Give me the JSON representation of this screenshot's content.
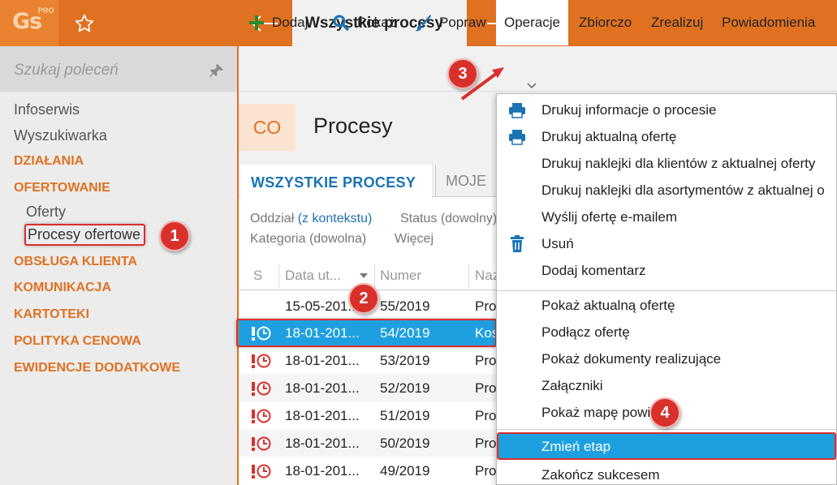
{
  "app": {
    "logo_text": "Gs",
    "logo_sup": "PRO",
    "tab_title": "Wszystkie procesy"
  },
  "sidebar": {
    "search_placeholder": "Szukaj poleceń",
    "items": [
      {
        "label": "Infoserwis",
        "kind": "item"
      },
      {
        "label": "Wyszukiwarka",
        "kind": "item"
      },
      {
        "label": "DZIAŁANIA",
        "kind": "section"
      },
      {
        "label": "OFERTOWANIE",
        "kind": "section"
      },
      {
        "label": "Oferty",
        "kind": "sub"
      },
      {
        "label": "Procesy ofertowe",
        "kind": "sub",
        "selected": true
      },
      {
        "label": "OBSŁUGA KLIENTA",
        "kind": "section"
      },
      {
        "label": "KOMUNIKACJA",
        "kind": "section"
      },
      {
        "label": "KARTOTEKI",
        "kind": "section"
      },
      {
        "label": "POLITYKA CENOWA",
        "kind": "section"
      },
      {
        "label": "EWIDENCJE DODATKOWE",
        "kind": "section"
      }
    ]
  },
  "toolbar": {
    "add": "Dodaj",
    "show": "Pokaż",
    "edit": "Popraw",
    "operations": "Operacje",
    "summary": "Zbiorczo",
    "realize": "Zrealizuj",
    "notifications": "Powiadomienia"
  },
  "page": {
    "code": "CO",
    "title": "Procesy",
    "tabs": [
      "WSZYSTKIE PROCESY",
      "MOJE"
    ],
    "filters": {
      "branch_label": "Oddział",
      "branch_value": "(z kontekstu)",
      "status_label": "Status",
      "status_value": "(dowolny)",
      "category_label": "Kategoria",
      "category_value": "(dowolna)",
      "more": "Więcej"
    }
  },
  "table": {
    "headers": {
      "s": "S",
      "date": "Data ut...",
      "number": "Numer",
      "name": "Naz"
    },
    "rows": [
      {
        "date": "15-05-201...",
        "number": "55/2019",
        "name": "Pro",
        "status": false,
        "selected": false
      },
      {
        "date": "18-01-201...",
        "number": "54/2019",
        "name": "Kos",
        "status": true,
        "selected": true
      },
      {
        "date": "18-01-201...",
        "number": "53/2019",
        "name": "Pro",
        "status": true,
        "selected": false
      },
      {
        "date": "18-01-201...",
        "number": "52/2019",
        "name": "Pro",
        "status": true,
        "selected": false
      },
      {
        "date": "18-01-201...",
        "number": "51/2019",
        "name": "Pro",
        "status": true,
        "selected": false
      },
      {
        "date": "18-01-201...",
        "number": "50/2019",
        "name": "Pro",
        "status": true,
        "selected": false
      },
      {
        "date": "18-01-201...",
        "number": "49/2019",
        "name": "Pro",
        "status": true,
        "selected": false
      }
    ]
  },
  "menu": {
    "items": [
      {
        "label": "Drukuj informacje o procesie",
        "icon": "printer-icon"
      },
      {
        "label": "Drukuj aktualną ofertę",
        "icon": "printer-icon"
      },
      {
        "label": "Drukuj naklejki dla klientów z aktualnej oferty",
        "icon": ""
      },
      {
        "label": "Drukuj naklejki dla asortymentów z aktualnej o",
        "icon": ""
      },
      {
        "label": "Wyślij ofertę e-mailem",
        "icon": ""
      },
      {
        "label": "Usuń",
        "icon": "trash-icon"
      },
      {
        "label": "Dodaj komentarz",
        "icon": ""
      },
      {
        "label": "Pokaż aktualną ofertę",
        "icon": ""
      },
      {
        "label": "Podłącz ofertę",
        "icon": ""
      },
      {
        "label": "Pokaż dokumenty realizujące",
        "icon": ""
      },
      {
        "label": "Załączniki",
        "icon": ""
      },
      {
        "label": "Pokaż mapę powiązań",
        "icon": ""
      },
      {
        "label": "Zmień etap",
        "icon": "",
        "highlighted": true
      },
      {
        "label": "Zakończ sukcesem",
        "icon": ""
      }
    ]
  },
  "annotations": [
    "1",
    "2",
    "3",
    "4"
  ],
  "colors": {
    "accent": "#e07121",
    "selection": "#1ea0e0",
    "callout": "#d9302c",
    "link": "#1a73b5",
    "status_red": "#d9302c"
  }
}
